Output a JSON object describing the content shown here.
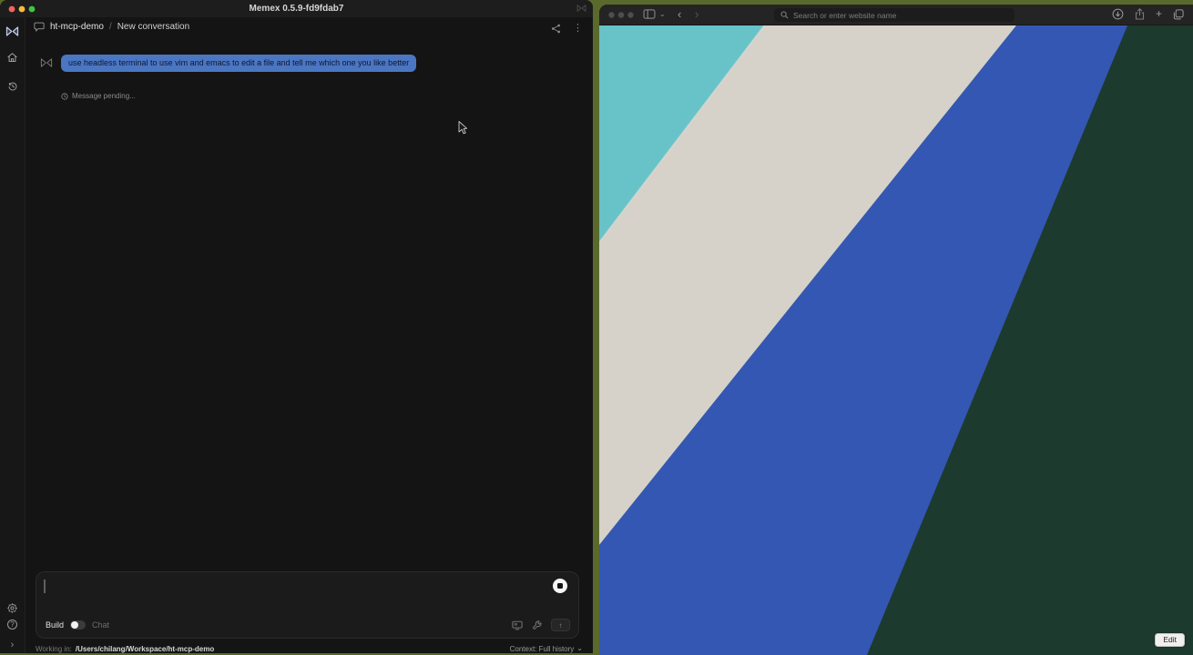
{
  "desktop": {
    "wallpaper_color": "#5a6a2c"
  },
  "memex": {
    "window_title": "Memex 0.5.9-fd9fdab7",
    "traffic_light_colors": [
      "#f4645c",
      "#f9bd36",
      "#3ec544"
    ],
    "breadcrumb": {
      "project": "ht-mcp-demo",
      "separator": "/",
      "page": "New conversation"
    },
    "chat": {
      "user_message": "use headless terminal to use vim and emacs to edit a file and tell me which one you like better",
      "pending_status": "Message pending...",
      "bubble_color": "#4b76c2"
    },
    "composer": {
      "mode_build": "Build",
      "mode_chat": "Chat"
    },
    "statusbar": {
      "working_label": "Working in:",
      "working_path": "/Users/chilang/Workspace/ht-mcp-demo",
      "context_label": "Context: Full history"
    }
  },
  "safari": {
    "traffic_light_color": "#4e4e4e",
    "address_placeholder": "Search or enter website name",
    "edit_button_label": "Edit",
    "wallpaper_colors": {
      "teal": "#68c3c9",
      "sand": "#d6d2ca",
      "blue": "#3457b4",
      "green": "#1d3a2f"
    }
  },
  "icons": {
    "kebab": "⋮",
    "back": "‹",
    "forward": "›",
    "chevron_down": "⌄",
    "plus": "+",
    "expand": "›",
    "help": "?",
    "send": "↑"
  }
}
